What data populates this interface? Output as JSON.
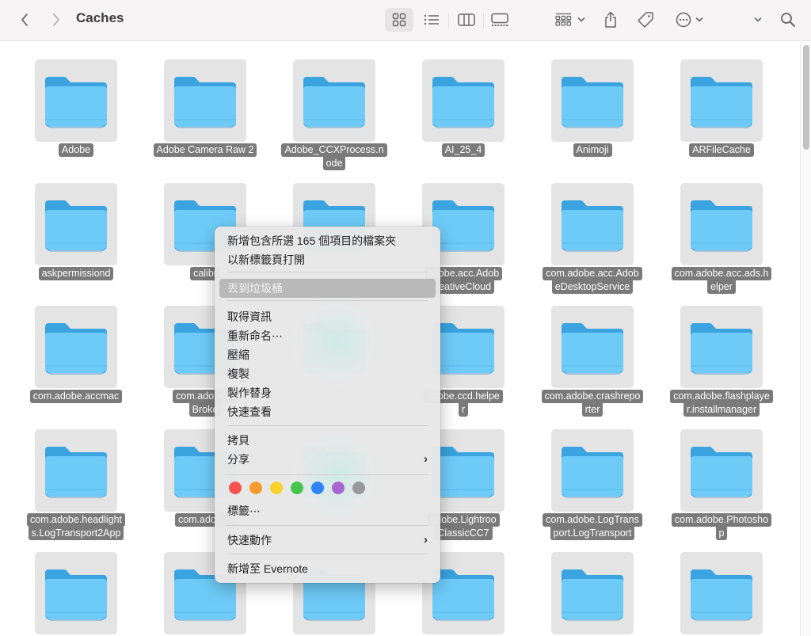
{
  "window": {
    "title": "Caches"
  },
  "toolbar": {
    "back": "back",
    "forward": "forward",
    "view_icon": "icon-view",
    "view_list": "list-view",
    "view_columns": "column-view",
    "view_gallery": "gallery-view",
    "group": "group-by",
    "share": "share",
    "tags": "tags",
    "more": "more-actions",
    "expand": "chevron-down",
    "search": "search"
  },
  "files": [
    {
      "lines": [
        "Adobe"
      ]
    },
    {
      "lines": [
        "Adobe Camera Raw 2"
      ]
    },
    {
      "lines": [
        "Adobe_CCXProcess.n",
        "ode"
      ]
    },
    {
      "lines": [
        "AI_25_4"
      ]
    },
    {
      "lines": [
        "Animoji"
      ]
    },
    {
      "lines": [
        "ARFileCache"
      ]
    },
    {
      "lines": [
        "askpermissiond"
      ]
    },
    {
      "lines": [
        "calibr"
      ]
    },
    {
      "lines": [
        ""
      ]
    },
    {
      "lines": [
        "adobe.acc.Adob",
        "reativeCloud"
      ]
    },
    {
      "lines": [
        "com.adobe.acc.Adob",
        "eDesktopService"
      ]
    },
    {
      "lines": [
        "com.adobe.acc.ads.h",
        "elper"
      ]
    },
    {
      "lines": [
        "com.adobe.accmac"
      ]
    },
    {
      "lines": [
        "com.adobe.A",
        "Broke"
      ]
    },
    {
      "lines": [
        ""
      ]
    },
    {
      "lines": [
        "adobe.ccd.helpe",
        "r"
      ]
    },
    {
      "lines": [
        "com.adobe.crashrepo",
        "rter"
      ]
    },
    {
      "lines": [
        "com.adobe.flashplaye",
        "r.installmanager"
      ]
    },
    {
      "lines": [
        "com.adobe.headlight",
        "s.LogTransport2App"
      ]
    },
    {
      "lines": [
        "com.adobe.i"
      ]
    },
    {
      "lines": [
        ""
      ]
    },
    {
      "lines": [
        "adobe.Lightroo",
        "ClassicCC7"
      ]
    },
    {
      "lines": [
        "com.adobe.LogTrans",
        "port.LogTransport"
      ]
    },
    {
      "lines": [
        "com.adobe.Photosho",
        "p"
      ]
    },
    {
      "lines": []
    },
    {
      "lines": []
    },
    {
      "lines": []
    },
    {
      "lines": []
    },
    {
      "lines": []
    },
    {
      "lines": []
    }
  ],
  "context_menu": {
    "items": [
      {
        "label": "新增包含所選 165 個項目的檔案夾"
      },
      {
        "label": "以新標籤頁打開"
      },
      {
        "label": "丟到垃圾桶",
        "highlighted": true
      },
      {
        "label": "取得資訊"
      },
      {
        "label": "重新命名⋯"
      },
      {
        "label": "壓縮"
      },
      {
        "label": "複製"
      },
      {
        "label": "製作替身"
      },
      {
        "label": "快速查看"
      },
      {
        "label": "拷貝"
      },
      {
        "label": "分享",
        "submenu": true
      },
      {
        "label": "標籤⋯"
      },
      {
        "label": "快速動作",
        "submenu": true
      },
      {
        "label": "新增至 Evernote"
      }
    ],
    "submenu_arrow": "›",
    "tag_colors": [
      {
        "name": "red",
        "color": "#f5534f"
      },
      {
        "name": "orange",
        "color": "#f79b2e"
      },
      {
        "name": "yellow",
        "color": "#f8d12f"
      },
      {
        "name": "green",
        "color": "#44c54e"
      },
      {
        "name": "blue",
        "color": "#2f85f7"
      },
      {
        "name": "purple",
        "color": "#a966d1"
      },
      {
        "name": "gray",
        "color": "#999999"
      }
    ]
  },
  "colors": {
    "folder_front": "#6ecbf8",
    "folder_back": "#3aa3e0",
    "label_bg": "#7a7a7a",
    "highlight": "#b9b9b9"
  }
}
